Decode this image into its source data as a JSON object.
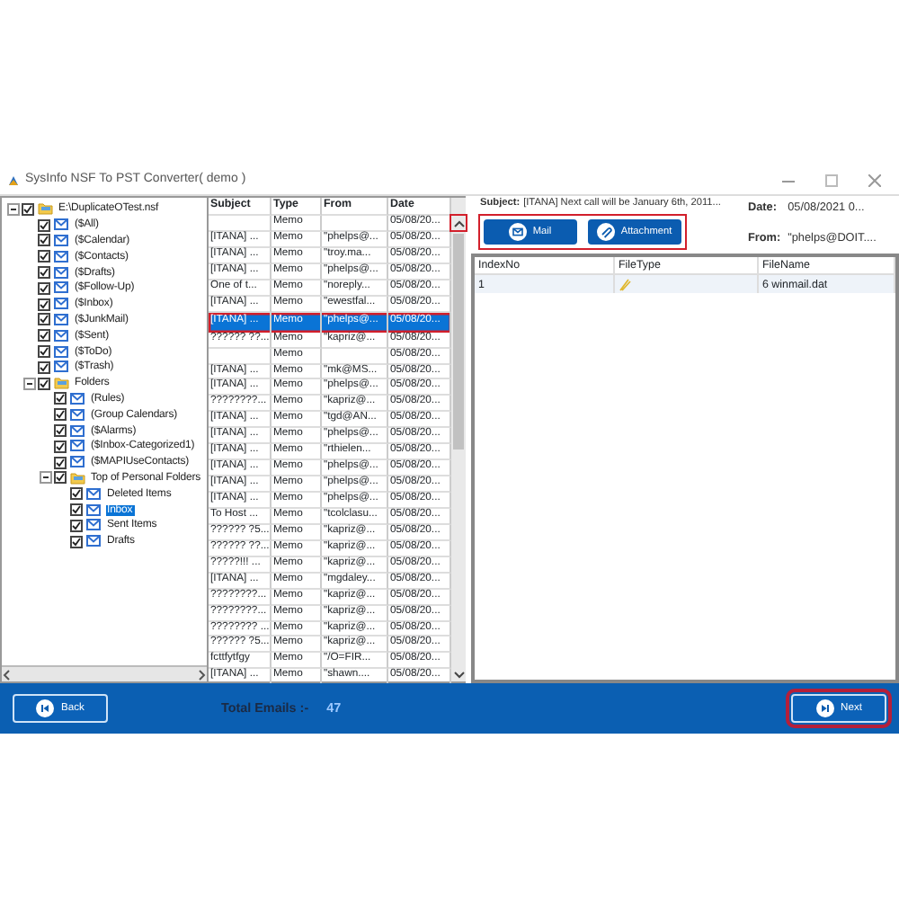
{
  "window": {
    "title": "SysInfo NSF To PST Converter( demo )"
  },
  "tree": [
    {
      "label": "E:\\DuplicateOTest.nsf",
      "kind": "folder",
      "checked": true,
      "expanded": true,
      "selected": false,
      "children": [
        {
          "label": "($All)",
          "kind": "mail",
          "checked": true,
          "selected": false
        },
        {
          "label": "($Calendar)",
          "kind": "mail",
          "checked": true,
          "selected": false
        },
        {
          "label": "($Contacts)",
          "kind": "mail",
          "checked": true,
          "selected": false
        },
        {
          "label": "($Drafts)",
          "kind": "mail",
          "checked": true,
          "selected": false
        },
        {
          "label": "($Follow-Up)",
          "kind": "mail",
          "checked": true,
          "selected": false
        },
        {
          "label": "($Inbox)",
          "kind": "mail",
          "checked": true,
          "selected": false
        },
        {
          "label": "($JunkMail)",
          "kind": "mail",
          "checked": true,
          "selected": false
        },
        {
          "label": "($Sent)",
          "kind": "mail",
          "checked": true,
          "selected": false
        },
        {
          "label": "($ToDo)",
          "kind": "mail",
          "checked": true,
          "selected": false
        },
        {
          "label": "($Trash)",
          "kind": "mail",
          "checked": true,
          "selected": false
        },
        {
          "label": "Folders",
          "kind": "folder",
          "checked": true,
          "expanded": true,
          "selected": false,
          "children": [
            {
              "label": "(Rules)",
              "kind": "mail",
              "checked": true,
              "selected": false
            },
            {
              "label": "(Group Calendars)",
              "kind": "mail",
              "checked": true,
              "selected": false
            },
            {
              "label": "($Alarms)",
              "kind": "mail",
              "checked": true,
              "selected": false
            },
            {
              "label": "($Inbox-Categorized1)",
              "kind": "mail",
              "checked": true,
              "selected": false
            },
            {
              "label": "($MAPIUseContacts)",
              "kind": "mail",
              "checked": true,
              "selected": false
            },
            {
              "label": "Top of Personal Folders",
              "kind": "folder",
              "checked": true,
              "expanded": true,
              "selected": false,
              "children": [
                {
                  "label": "Deleted Items",
                  "kind": "mail",
                  "checked": true,
                  "selected": false
                },
                {
                  "label": "Inbox",
                  "kind": "mail",
                  "checked": true,
                  "selected": true
                },
                {
                  "label": "Sent Items",
                  "kind": "mail",
                  "checked": true,
                  "selected": false
                },
                {
                  "label": "Drafts",
                  "kind": "mail",
                  "checked": true,
                  "selected": false
                }
              ]
            }
          ]
        }
      ]
    }
  ],
  "messages": {
    "columns": [
      "Subject",
      "Type",
      "From",
      "Date"
    ],
    "scroll_up_highlighted": true,
    "rows": [
      {
        "cells": [
          "",
          "Memo",
          "",
          "05/08/20..."
        ],
        "selected": false,
        "highlighted": false
      },
      {
        "cells": [
          "[ITANA] ...",
          "Memo",
          "\"phelps@...",
          "05/08/20..."
        ],
        "selected": false,
        "highlighted": false
      },
      {
        "cells": [
          "[ITANA] ...",
          "Memo",
          "\"troy.ma...",
          "05/08/20..."
        ],
        "selected": false,
        "highlighted": false
      },
      {
        "cells": [
          "[ITANA] ...",
          "Memo",
          "\"phelps@...",
          "05/08/20..."
        ],
        "selected": false,
        "highlighted": false
      },
      {
        "cells": [
          "One of t...",
          "Memo",
          "\"noreply...",
          "05/08/20..."
        ],
        "selected": false,
        "highlighted": false
      },
      {
        "cells": [
          "[ITANA] ...",
          "Memo",
          "\"ewestfal...",
          "05/08/20..."
        ],
        "selected": false,
        "highlighted": false
      },
      {
        "cells": [
          "[ITANA] ...",
          "Memo",
          "\"phelps@...",
          "05/08/20..."
        ],
        "selected": true,
        "highlighted": true
      },
      {
        "cells": [
          "?????? ??...",
          "Memo",
          "\"kapriz@...",
          "05/08/20..."
        ],
        "selected": false,
        "highlighted": false
      },
      {
        "cells": [
          "",
          "Memo",
          "",
          "05/08/20..."
        ],
        "selected": false,
        "highlighted": false
      },
      {
        "cells": [
          "[ITANA] ...",
          "Memo",
          "\"mk@MS...",
          "05/08/20..."
        ],
        "selected": false,
        "highlighted": false
      },
      {
        "cells": [
          "[ITANA] ...",
          "Memo",
          "\"phelps@...",
          "05/08/20..."
        ],
        "selected": false,
        "highlighted": false
      },
      {
        "cells": [
          "????????...",
          "Memo",
          "\"kapriz@...",
          "05/08/20..."
        ],
        "selected": false,
        "highlighted": false
      },
      {
        "cells": [
          "[ITANA] ...",
          "Memo",
          "\"tgd@AN...",
          "05/08/20..."
        ],
        "selected": false,
        "highlighted": false
      },
      {
        "cells": [
          "[ITANA] ...",
          "Memo",
          "\"phelps@...",
          "05/08/20..."
        ],
        "selected": false,
        "highlighted": false
      },
      {
        "cells": [
          "[ITANA] ...",
          "Memo",
          "\"rthielen...",
          "05/08/20..."
        ],
        "selected": false,
        "highlighted": false
      },
      {
        "cells": [
          "[ITANA] ...",
          "Memo",
          "\"phelps@...",
          "05/08/20..."
        ],
        "selected": false,
        "highlighted": false
      },
      {
        "cells": [
          "[ITANA] ...",
          "Memo",
          "\"phelps@...",
          "05/08/20..."
        ],
        "selected": false,
        "highlighted": false
      },
      {
        "cells": [
          "[ITANA] ...",
          "Memo",
          "\"phelps@...",
          "05/08/20..."
        ],
        "selected": false,
        "highlighted": false
      },
      {
        "cells": [
          "To Host ...",
          "Memo",
          "\"tcolclasu...",
          "05/08/20..."
        ],
        "selected": false,
        "highlighted": false
      },
      {
        "cells": [
          "?????? ?5...",
          "Memo",
          "\"kapriz@...",
          "05/08/20..."
        ],
        "selected": false,
        "highlighted": false
      },
      {
        "cells": [
          "?????? ??...",
          "Memo",
          "\"kapriz@...",
          "05/08/20..."
        ],
        "selected": false,
        "highlighted": false
      },
      {
        "cells": [
          "?????!!! ...",
          "Memo",
          "\"kapriz@...",
          "05/08/20..."
        ],
        "selected": false,
        "highlighted": false
      },
      {
        "cells": [
          "[ITANA] ...",
          "Memo",
          "\"mgdaley...",
          "05/08/20..."
        ],
        "selected": false,
        "highlighted": false
      },
      {
        "cells": [
          "????????...",
          "Memo",
          "\"kapriz@...",
          "05/08/20..."
        ],
        "selected": false,
        "highlighted": false
      },
      {
        "cells": [
          "????????...",
          "Memo",
          "\"kapriz@...",
          "05/08/20..."
        ],
        "selected": false,
        "highlighted": false
      },
      {
        "cells": [
          "???????? ...",
          "Memo",
          "\"kapriz@...",
          "05/08/20..."
        ],
        "selected": false,
        "highlighted": false
      },
      {
        "cells": [
          "?????? ?5...",
          "Memo",
          "\"kapriz@...",
          "05/08/20..."
        ],
        "selected": false,
        "highlighted": false
      },
      {
        "cells": [
          "fcttfytfgy",
          "Memo",
          "\"/O=FIR...",
          "05/08/20..."
        ],
        "selected": false,
        "highlighted": false
      },
      {
        "cells": [
          "[ITANA] ...",
          "Memo",
          "\"shawn....",
          "05/08/20..."
        ],
        "selected": false,
        "highlighted": false
      }
    ]
  },
  "preview": {
    "subject_label": "Subject:",
    "subject": "[ITANA] Next call will be January 6th, 2011...",
    "date_label": "Date:",
    "date": "05/08/2021 0...",
    "from_label": "From:",
    "from": "\"phelps@DOIT....",
    "buttons_highlighted": true,
    "buttons": [
      {
        "label": "Mail",
        "kind": "mail"
      },
      {
        "label": "Attachment",
        "kind": "attachment"
      }
    ]
  },
  "attachments": {
    "columns": [
      "IndexNo",
      "FileType",
      "FileName"
    ],
    "rows": [
      {
        "index": "1",
        "file_name": "6 winmail.dat"
      }
    ]
  },
  "footer": {
    "back": "Back",
    "total_label": "Total Emails :-",
    "total": "47",
    "next": "Next",
    "next_highlighted": true
  }
}
